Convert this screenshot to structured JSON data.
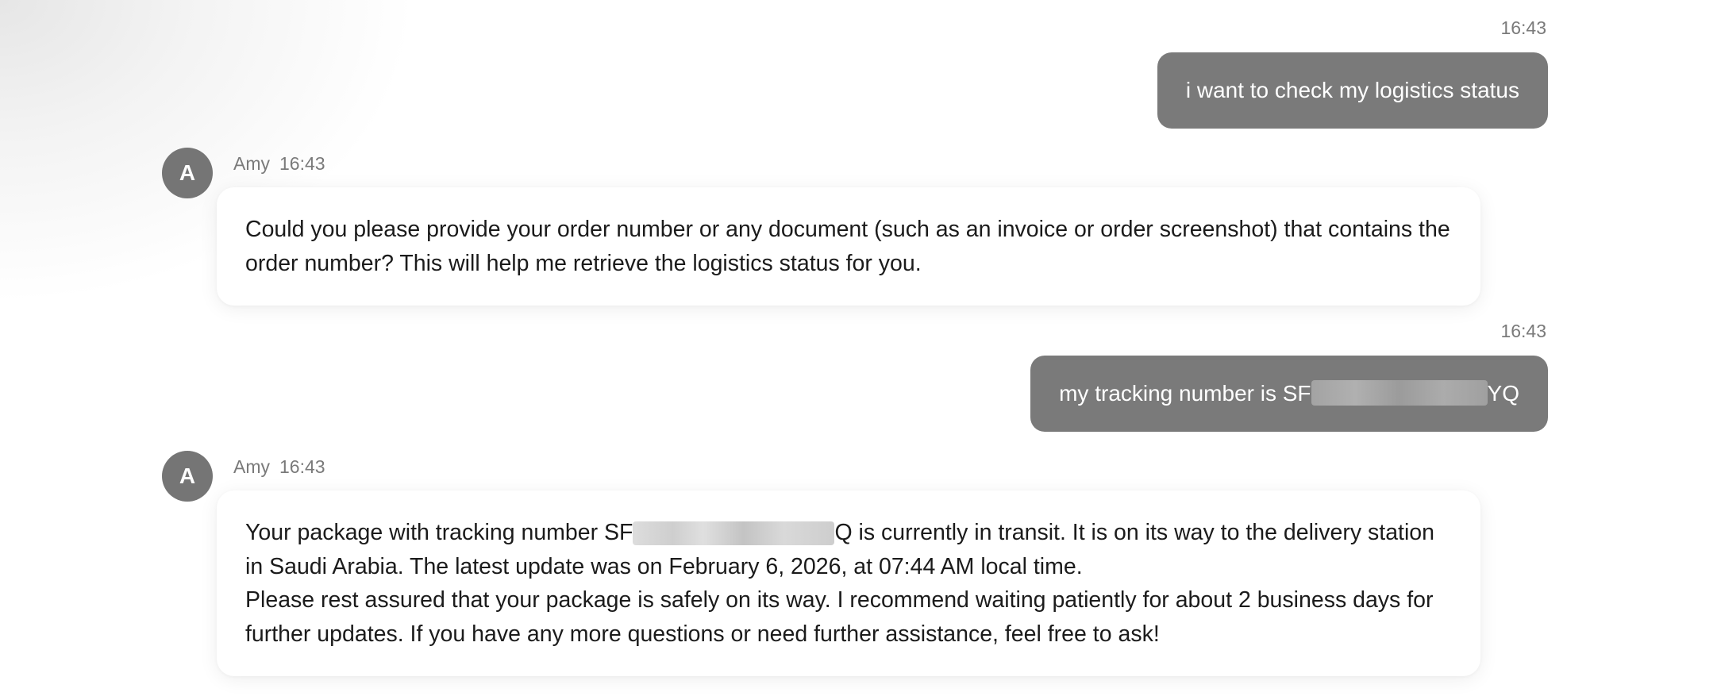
{
  "messages": [
    {
      "role": "user",
      "time": "16:43",
      "text": "i want to check my logistics status"
    },
    {
      "role": "agent",
      "avatar_letter": "A",
      "name": "Amy",
      "time": "16:43",
      "text": "Could you please provide your order number or any document (such as an invoice or order screenshot) that contains the order number? This will help me retrieve the logistics status for you."
    },
    {
      "role": "user",
      "time": "16:43",
      "text_before": "my tracking number is SF",
      "text_after": "YQ"
    },
    {
      "role": "agent",
      "avatar_letter": "A",
      "name": "Amy",
      "time": "16:43",
      "p1_before": "Your package with tracking number SF",
      "p1_after": "Q is currently in transit. It is on its way to the delivery station in Saudi Arabia. The latest update was on February 6, 2026, at 07:44 AM local time.",
      "p2": "Please rest assured that your package is safely on its way. I recommend waiting patiently for about 2 business days for further updates. If you have any more questions or need further assistance, feel free to ask!"
    }
  ],
  "colors": {
    "user_bubble": "#7a7a7a",
    "avatar": "#757575",
    "timestamp": "#7a7a7a",
    "bot_bubble": "#ffffff"
  }
}
